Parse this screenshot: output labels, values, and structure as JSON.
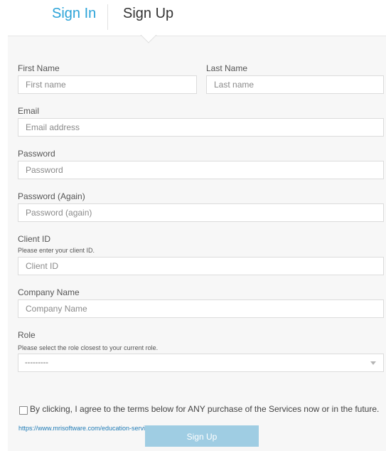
{
  "tabs": {
    "sign_in": "Sign In",
    "sign_up": "Sign Up"
  },
  "form": {
    "first_name": {
      "label": "First Name",
      "placeholder": "First name"
    },
    "last_name": {
      "label": "Last Name",
      "placeholder": "Last name"
    },
    "email": {
      "label": "Email",
      "placeholder": "Email address"
    },
    "password": {
      "label": "Password",
      "placeholder": "Password"
    },
    "password_again": {
      "label": "Password (Again)",
      "placeholder": "Password (again)"
    },
    "client_id": {
      "label": "Client ID",
      "hint": "Please enter your client ID.",
      "placeholder": "Client ID"
    },
    "company_name": {
      "label": "Company Name",
      "placeholder": "Company Name"
    },
    "role": {
      "label": "Role",
      "hint": "Please select the role closest to your current role.",
      "selected": "---------"
    },
    "terms": {
      "text": "By clicking, I agree to the terms below for ANY purchase of the Services now or in the future.",
      "link": "https://www.mrisoftware.com/education-services-terms-conditions/"
    },
    "submit_label": "Sign Up"
  },
  "colors": {
    "accent": "#2ba3d8",
    "panel_bg": "#f7f7f7",
    "button_bg": "#9fcde3",
    "link": "#1f7bb6"
  }
}
